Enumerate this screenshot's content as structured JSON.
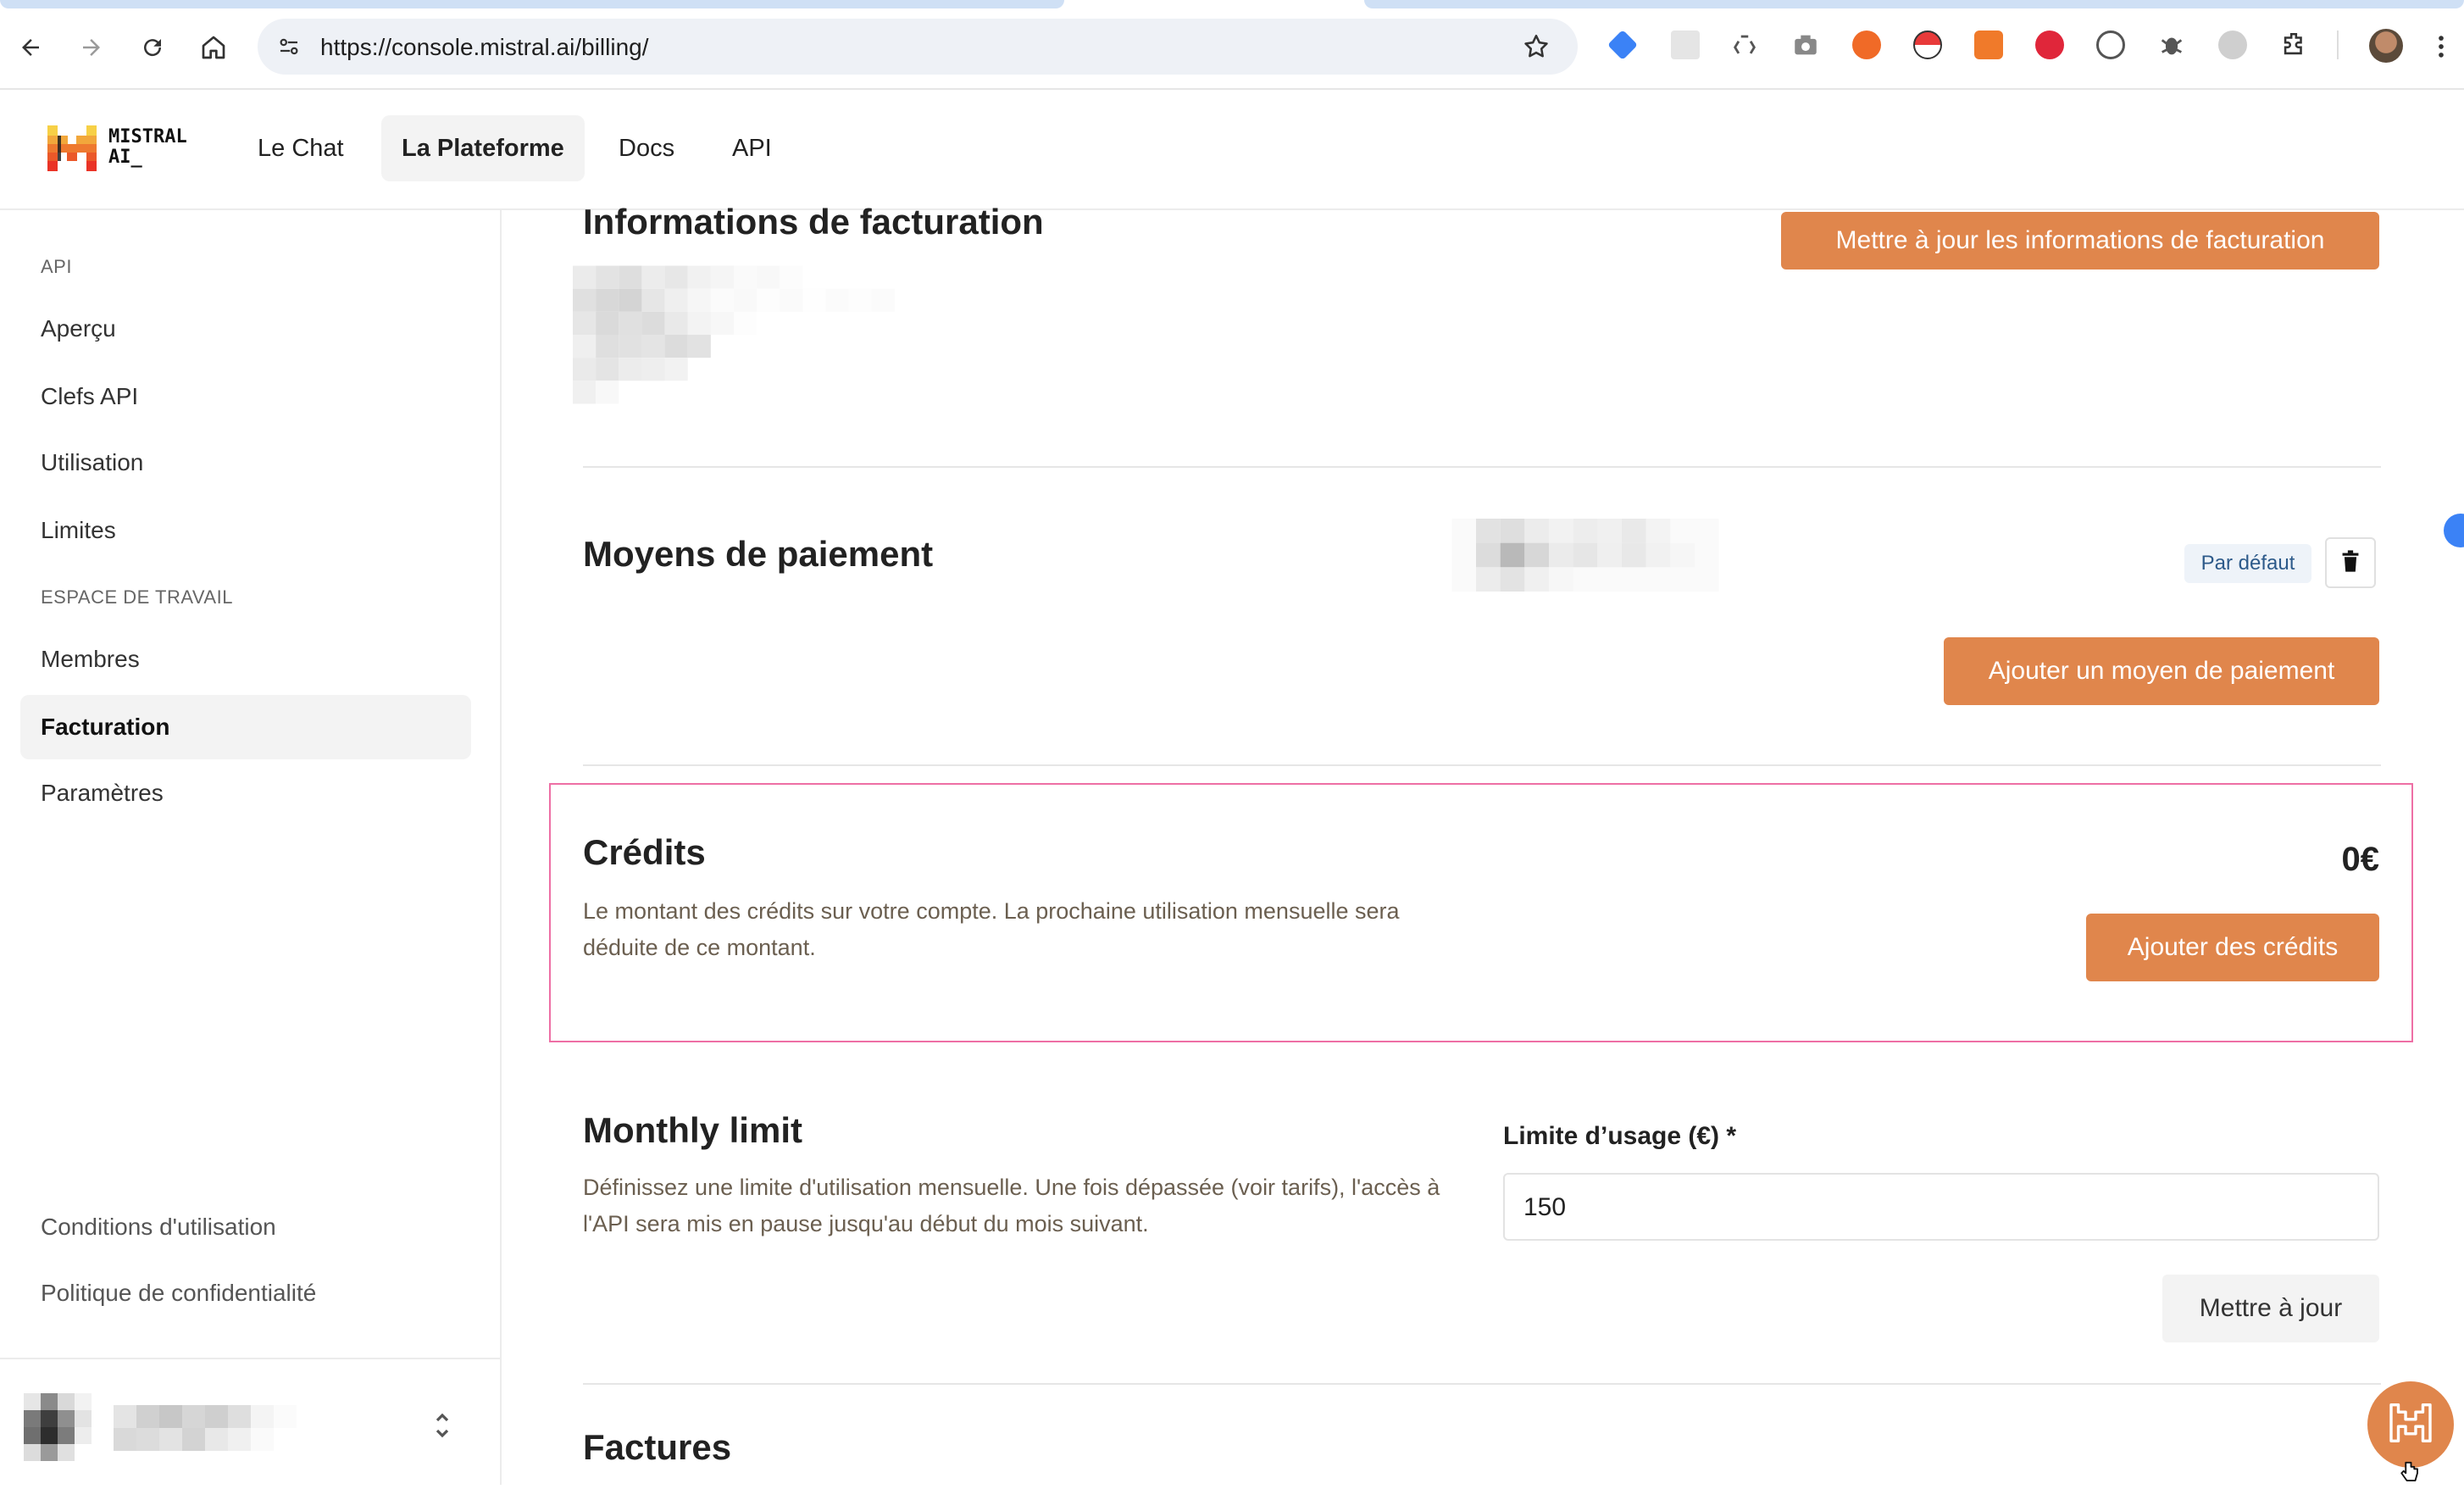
{
  "browser": {
    "url": "https://console.mistral.ai/billing/",
    "nav": {
      "back_icon": "arrow-left-icon",
      "forward_icon": "arrow-right-icon",
      "reload_icon": "reload-icon",
      "home_icon": "home-icon"
    }
  },
  "brand": {
    "line1": "MISTRAL",
    "line2": "AI_",
    "colors": [
      "#f7d046",
      "#f2a73b",
      "#ee792f",
      "#eb5829",
      "#ea3326",
      "#1f1f1f"
    ]
  },
  "header": {
    "tabs": [
      {
        "label": "Le Chat"
      },
      {
        "label": "La Plateforme"
      },
      {
        "label": "Docs"
      },
      {
        "label": "API"
      }
    ]
  },
  "sidebar": {
    "section_api": "API",
    "api_items": [
      {
        "label": "Aperçu"
      },
      {
        "label": "Clefs API"
      },
      {
        "label": "Utilisation"
      },
      {
        "label": "Limites"
      }
    ],
    "section_workspace": "ESPACE DE TRAVAIL",
    "workspace_items": [
      {
        "label": "Membres"
      },
      {
        "label": "Facturation"
      },
      {
        "label": "Paramètres"
      }
    ],
    "footer_links": [
      {
        "label": "Conditions d'utilisation"
      },
      {
        "label": "Politique de confidentialité"
      }
    ]
  },
  "billing_info": {
    "title": "Informations de facturation",
    "update_button": "Mettre à jour les informations de facturation"
  },
  "payment": {
    "title": "Moyens de paiement",
    "default_badge": "Par défaut",
    "add_button": "Ajouter un moyen de paiement"
  },
  "credits": {
    "title": "Crédits",
    "description": "Le montant des crédits sur votre compte. La prochaine utilisation mensuelle sera déduite de ce montant.",
    "amount": "0€",
    "add_button": "Ajouter des crédits"
  },
  "monthly_limit": {
    "title": "Monthly limit",
    "description": "Définissez une limite d'utilisation mensuelle. Une fois dépassée (voir tarifs), l'accès à l'API sera mis en pause jusqu'au début du mois suivant.",
    "field_label": "Limite d’usage (€) *",
    "field_value": "150",
    "update_button": "Mettre à jour"
  },
  "invoices": {
    "title": "Factures"
  },
  "colors": {
    "accent": "#e0864c",
    "highlight_border": "#ee6fa5",
    "badge_bg": "#eef3f9",
    "badge_text": "#2d5a8a"
  }
}
